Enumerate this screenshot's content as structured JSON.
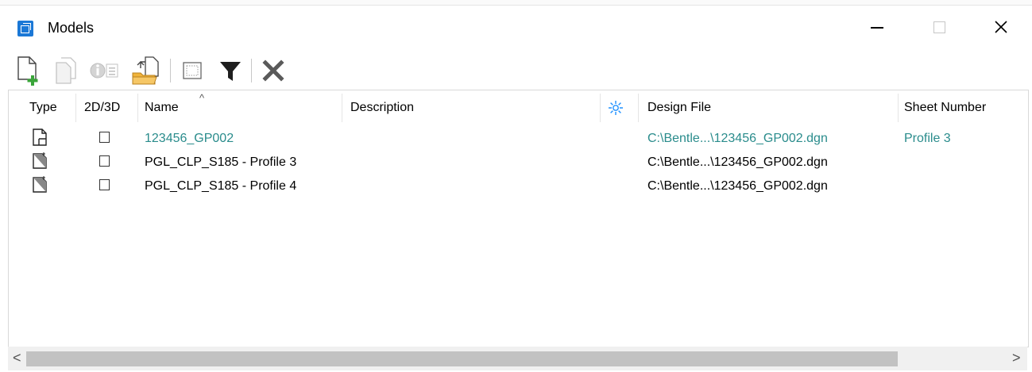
{
  "window": {
    "title": "Models",
    "controls": {
      "minimize": "—",
      "close": "✕"
    }
  },
  "toolbar": {
    "buttons": [
      {
        "name": "create-model",
        "icon": "new-model-icon",
        "enabled": true
      },
      {
        "name": "copy-model",
        "icon": "copy-model-icon",
        "enabled": false
      },
      {
        "name": "model-properties",
        "icon": "properties-icon",
        "enabled": false
      },
      {
        "name": "import-model",
        "icon": "import-folder-icon",
        "enabled": true
      },
      {
        "name": "select-view",
        "icon": "select-box-icon",
        "enabled": true
      },
      {
        "name": "filter",
        "icon": "filter-icon",
        "enabled": true
      },
      {
        "name": "delete-model",
        "icon": "delete-x-icon",
        "enabled": true
      }
    ],
    "colors": {
      "green": "#3aa53a",
      "folder": "#f0b33a",
      "dark": "#333333",
      "disabled": "#bdbdbd"
    }
  },
  "table": {
    "columns": {
      "type": "Type",
      "dim": "2D/3D",
      "name": "Name",
      "sort_indicator": "^",
      "description": "Description",
      "design_file": "Design File",
      "sheet_number": "Sheet Number"
    },
    "rows": [
      {
        "type_icon": "sheet-model-icon",
        "name": "123456_GP002",
        "description": "",
        "design_file": "C:\\Bentle...\\123456_GP002.dgn",
        "sheet_number": "Profile 3",
        "active": true
      },
      {
        "type_icon": "drawing-model-icon",
        "name": "PGL_CLP_S185 - Profile 3",
        "description": "",
        "design_file": "C:\\Bentle...\\123456_GP002.dgn",
        "sheet_number": "",
        "active": false
      },
      {
        "type_icon": "drawing-model-icon",
        "name": "PGL_CLP_S185 - Profile 4",
        "description": "",
        "design_file": "C:\\Bentle...\\123456_GP002.dgn",
        "sheet_number": "",
        "active": false
      }
    ],
    "active_color": "#2a8c8c",
    "header_icon_color": "#1e90ff"
  },
  "scrollbar": {
    "left_arrow": "<",
    "right_arrow": ">"
  }
}
